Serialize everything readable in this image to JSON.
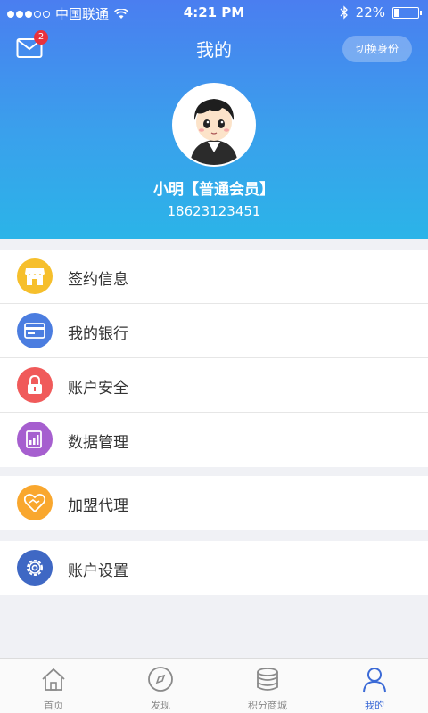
{
  "status_bar": {
    "carrier": "中国联通",
    "time": "4:21 PM",
    "battery_percent": "22%",
    "battery_level": 0.22
  },
  "header": {
    "title": "我的",
    "mail_badge_count": "2",
    "switch_identity_label": "切换身份"
  },
  "profile": {
    "name": "小明",
    "member_level": "【普通会员】",
    "phone": "18623123451"
  },
  "menu_groups": [
    [
      {
        "label": "签约信息",
        "icon": "shop-icon",
        "color": "#f6bf2c"
      },
      {
        "label": "我的银行",
        "icon": "bank-card-icon",
        "color": "#4b7de0"
      },
      {
        "label": "账户安全",
        "icon": "lock-icon",
        "color": "#f05a5a"
      },
      {
        "label": "数据管理",
        "icon": "data-chart-icon",
        "color": "#a65fcf"
      }
    ],
    [
      {
        "label": "加盟代理",
        "icon": "handshake-icon",
        "color": "#f9a72e"
      }
    ],
    [
      {
        "label": "账户设置",
        "icon": "gear-icon",
        "color": "#3f68c4"
      }
    ]
  ],
  "tabs": [
    {
      "label": "首页",
      "icon": "home-icon",
      "active": false
    },
    {
      "label": "发现",
      "icon": "compass-icon",
      "active": false
    },
    {
      "label": "积分商城",
      "icon": "coins-icon",
      "active": false
    },
    {
      "label": "我的",
      "icon": "user-icon",
      "active": true
    }
  ],
  "colors": {
    "header_top": "#4a7ef0",
    "header_bottom": "#2bb4e8",
    "tab_active": "#3b6ad6"
  }
}
